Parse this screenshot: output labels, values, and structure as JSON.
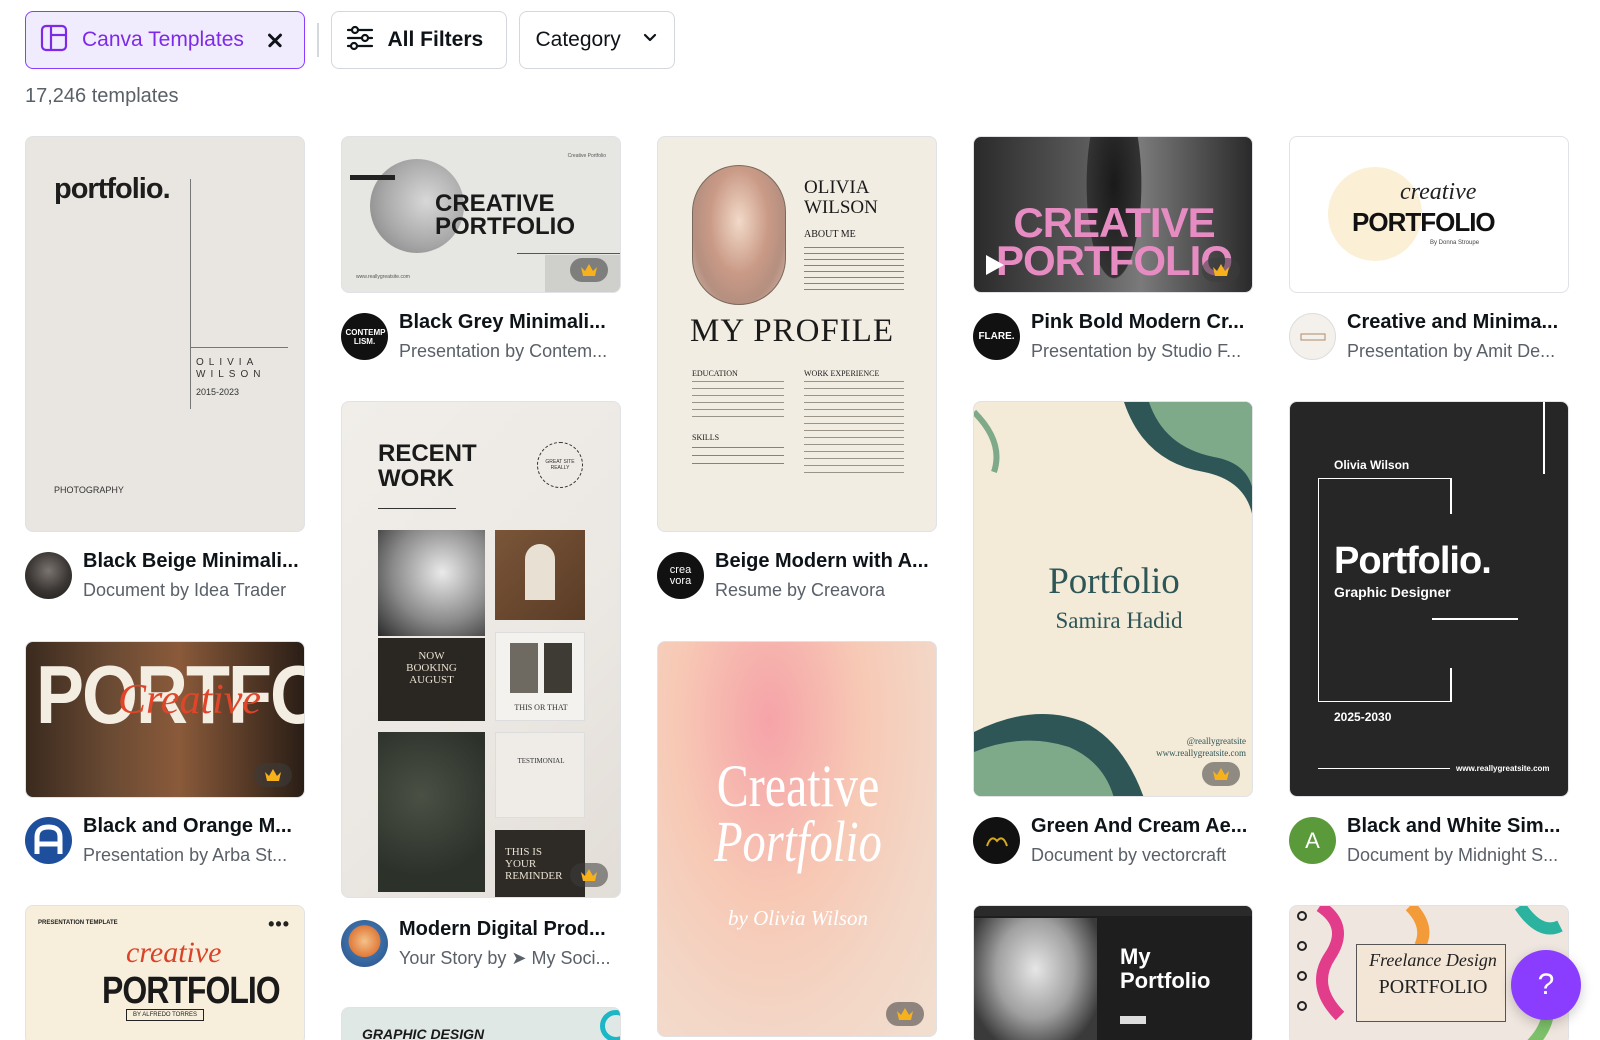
{
  "filters": {
    "canva_templates_label": "Canva Templates",
    "all_filters_label": "All Filters",
    "category_label": "Category"
  },
  "results": {
    "count_text": "17,246 templates"
  },
  "colors": {
    "accent": "#8b3dff",
    "accent_text": "#7d2ae8",
    "accent_bg": "#f1ebfe"
  },
  "cards": {
    "c1": {
      "title": "Black Beige Minimali...",
      "subtitle": "Document by Idea Trader",
      "thumb": {
        "brand": "portfolio.",
        "name1": "OLIVIA",
        "name2": "WILSON",
        "years": "2015-2023",
        "footer": "PHOTOGRAPHY"
      }
    },
    "c2": {
      "title": "Black and Orange M...",
      "subtitle": "Presentation by Arba St...",
      "thumb": {
        "big": "PORTFOLIO",
        "script": "Creative"
      }
    },
    "c3": {
      "thumb": {
        "top": "PRESENTATION TEMPLATE",
        "script": "creative",
        "big": "PORTFOLIO",
        "by": "BY ALFREDO TORRES"
      }
    },
    "c4": {
      "title": "Black Grey Minimali...",
      "subtitle": "Presentation by Contem...",
      "avatar": "CONTEMP LISM.",
      "thumb": {
        "line1": "CREATIVE",
        "line2": "PORTFOLIO",
        "corner": "Creative Portfolio",
        "url": "www.reallygreatsite.com"
      }
    },
    "c5": {
      "title": "Modern Digital Prod...",
      "subtitle": "Your Story by ➤ My Soci...",
      "thumb": {
        "head1": "RECENT",
        "head2": "WORK",
        "circle": "GREAT SITE REALLY",
        "booking1": "NOW",
        "booking2": "BOOKING",
        "booking3": "AUGUST",
        "this_or_that": "THIS OR THAT",
        "testimonial": "TESTIMONIAL",
        "reminder1": "THIS IS",
        "reminder2": "YOUR",
        "reminder3": "REMINDER"
      }
    },
    "c6": {
      "thumb": {
        "text": "GRAPHIC DESIGN"
      }
    },
    "c7": {
      "title": "Beige Modern with A...",
      "subtitle": "Resume by Creavora",
      "avatar": "crea vora",
      "thumb": {
        "name1": "OLIVIA",
        "name2": "WILSON",
        "about": "ABOUT ME",
        "headline": "MY PROFILE",
        "edu": "EDUCATION",
        "work": "WORK EXPERIENCE",
        "skills": "SKILLS"
      }
    },
    "c8": {
      "thumb": {
        "line1": "Creative",
        "line2": "Portfolio",
        "by": "by Olivia Wilson"
      }
    },
    "c9": {
      "title": "Pink Bold Modern Cr...",
      "subtitle": "Presentation by Studio F...",
      "avatar": "FLARE.",
      "thumb": {
        "line1": "CREATIVE",
        "line2": "PORTFOLIO"
      }
    },
    "c10": {
      "title": "Green And Cream Ae...",
      "subtitle": "Document by vectorcraft",
      "thumb": {
        "headline": "Portfolio",
        "name": "Samira Hadid",
        "handle": "@reallygreatsite",
        "url": "www.reallygreatsite.com"
      }
    },
    "c11": {
      "thumb": {
        "line1": "My",
        "line2": "Portfolio"
      }
    },
    "c12": {
      "title": "Creative and Minima...",
      "subtitle": "Presentation by Amit De...",
      "thumb": {
        "script": "creative",
        "big": "PORTFOLIO",
        "by": "By Donna Stroupe"
      }
    },
    "c13": {
      "title": "Black and White Sim...",
      "subtitle": "Document by Midnight S...",
      "avatar": "A",
      "thumb": {
        "name": "Olivia Wilson",
        "headline": "Portfolio.",
        "role": "Graphic Designer",
        "years": "2025-2030",
        "url": "www.reallygreatsite.com"
      }
    },
    "c14": {
      "thumb": {
        "script": "Freelance Design",
        "big": "PORTFOLIO"
      }
    }
  },
  "help": {
    "label": "?"
  }
}
